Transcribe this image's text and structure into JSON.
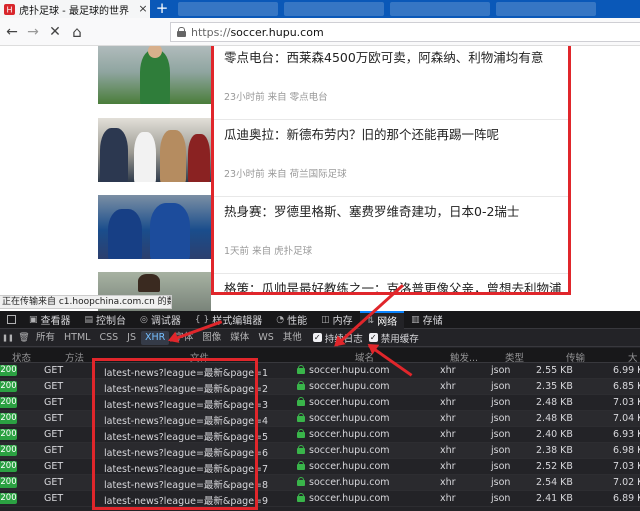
{
  "browser": {
    "tab_title": "虎扑足球 - 最足球的世界",
    "tab_close": "×",
    "new_tab": "+",
    "url_prefix": "https://",
    "url_host": "soccer.hupu.com",
    "back_icon": "←",
    "forward_icon": "→",
    "stop_icon": "✕",
    "home_icon": "⌂"
  },
  "news": [
    {
      "title": "零点电台：西莱森4500万欧可卖，阿森纳、利物浦均有意",
      "meta": "23小时前 来自 零点电台"
    },
    {
      "title": "瓜迪奥拉：新德布劳内？旧的那个还能再踢一阵呢",
      "meta": "23小时前 来自 荷兰国际足球"
    },
    {
      "title": "热身赛：罗德里格斯、塞费罗维奇建功，日本0-2瑞士",
      "meta": "1天前 来自 虎扑足球"
    },
    {
      "title": "格策：瓜帅是最好教练之一：克洛普更像父亲，曾想去利物浦",
      "meta": ""
    }
  ],
  "status_tip": "正在传输来自 c1.hoopchina.com.cn 的数据...",
  "devtools": {
    "tabs": [
      {
        "icon": "▣",
        "label": "查看器"
      },
      {
        "icon": "▤",
        "label": "控制台"
      },
      {
        "icon": "◎",
        "label": "调试器"
      },
      {
        "icon": "{ }",
        "label": "样式编辑器"
      },
      {
        "icon": "◔",
        "label": "性能"
      },
      {
        "icon": "◫",
        "label": "内存"
      },
      {
        "icon": "⇅",
        "label": "网络"
      },
      {
        "icon": "▥",
        "label": "存储"
      }
    ],
    "selected_tab": "网络",
    "filters": [
      "所有",
      "HTML",
      "CSS",
      "JS",
      "XHR",
      "字体",
      "图像",
      "媒体",
      "WS",
      "其他"
    ],
    "active_filter": "XHR",
    "pause_icon": "❚❚",
    "trash_icon": "🗑",
    "persist_log_label": "持续日志",
    "disable_cache_label": "禁用缓存",
    "check_mark": "✓",
    "columns": {
      "status": "状态",
      "method": "方法",
      "file": "文件",
      "domain": "域名",
      "cause": "触发...",
      "type": "类型",
      "transferred": "传输",
      "size": "大"
    },
    "rows": [
      {
        "status": "200",
        "method": "GET",
        "file": "latest-news?league=最新&page=1",
        "domain": "soccer.hupu.com",
        "cause": "xhr",
        "type": "json",
        "transferred": "2.55 KB",
        "size": "6.99 K"
      },
      {
        "status": "200",
        "method": "GET",
        "file": "latest-news?league=最新&page=2",
        "domain": "soccer.hupu.com",
        "cause": "xhr",
        "type": "json",
        "transferred": "2.35 KB",
        "size": "6.85 K"
      },
      {
        "status": "200",
        "method": "GET",
        "file": "latest-news?league=最新&page=3",
        "domain": "soccer.hupu.com",
        "cause": "xhr",
        "type": "json",
        "transferred": "2.48 KB",
        "size": "7.03 K"
      },
      {
        "status": "200",
        "method": "GET",
        "file": "latest-news?league=最新&page=4",
        "domain": "soccer.hupu.com",
        "cause": "xhr",
        "type": "json",
        "transferred": "2.48 KB",
        "size": "7.04 K"
      },
      {
        "status": "200",
        "method": "GET",
        "file": "latest-news?league=最新&page=5",
        "domain": "soccer.hupu.com",
        "cause": "xhr",
        "type": "json",
        "transferred": "2.40 KB",
        "size": "6.93 K"
      },
      {
        "status": "200",
        "method": "GET",
        "file": "latest-news?league=最新&page=6",
        "domain": "soccer.hupu.com",
        "cause": "xhr",
        "type": "json",
        "transferred": "2.38 KB",
        "size": "6.98 K"
      },
      {
        "status": "200",
        "method": "GET",
        "file": "latest-news?league=最新&page=7",
        "domain": "soccer.hupu.com",
        "cause": "xhr",
        "type": "json",
        "transferred": "2.52 KB",
        "size": "7.03 K"
      },
      {
        "status": "200",
        "method": "GET",
        "file": "latest-news?league=最新&page=8",
        "domain": "soccer.hupu.com",
        "cause": "xhr",
        "type": "json",
        "transferred": "2.54 KB",
        "size": "7.02 K"
      },
      {
        "status": "200",
        "method": "GET",
        "file": "latest-news?league=最新&page=9",
        "domain": "soccer.hupu.com",
        "cause": "xhr",
        "type": "json",
        "transferred": "2.41 KB",
        "size": "6.89 K"
      }
    ]
  },
  "colors": {
    "annotation": "#e0262b",
    "status_ok": "#2ba142",
    "devtools_bg": "#232327",
    "tabstrip": "#0a58b8"
  }
}
